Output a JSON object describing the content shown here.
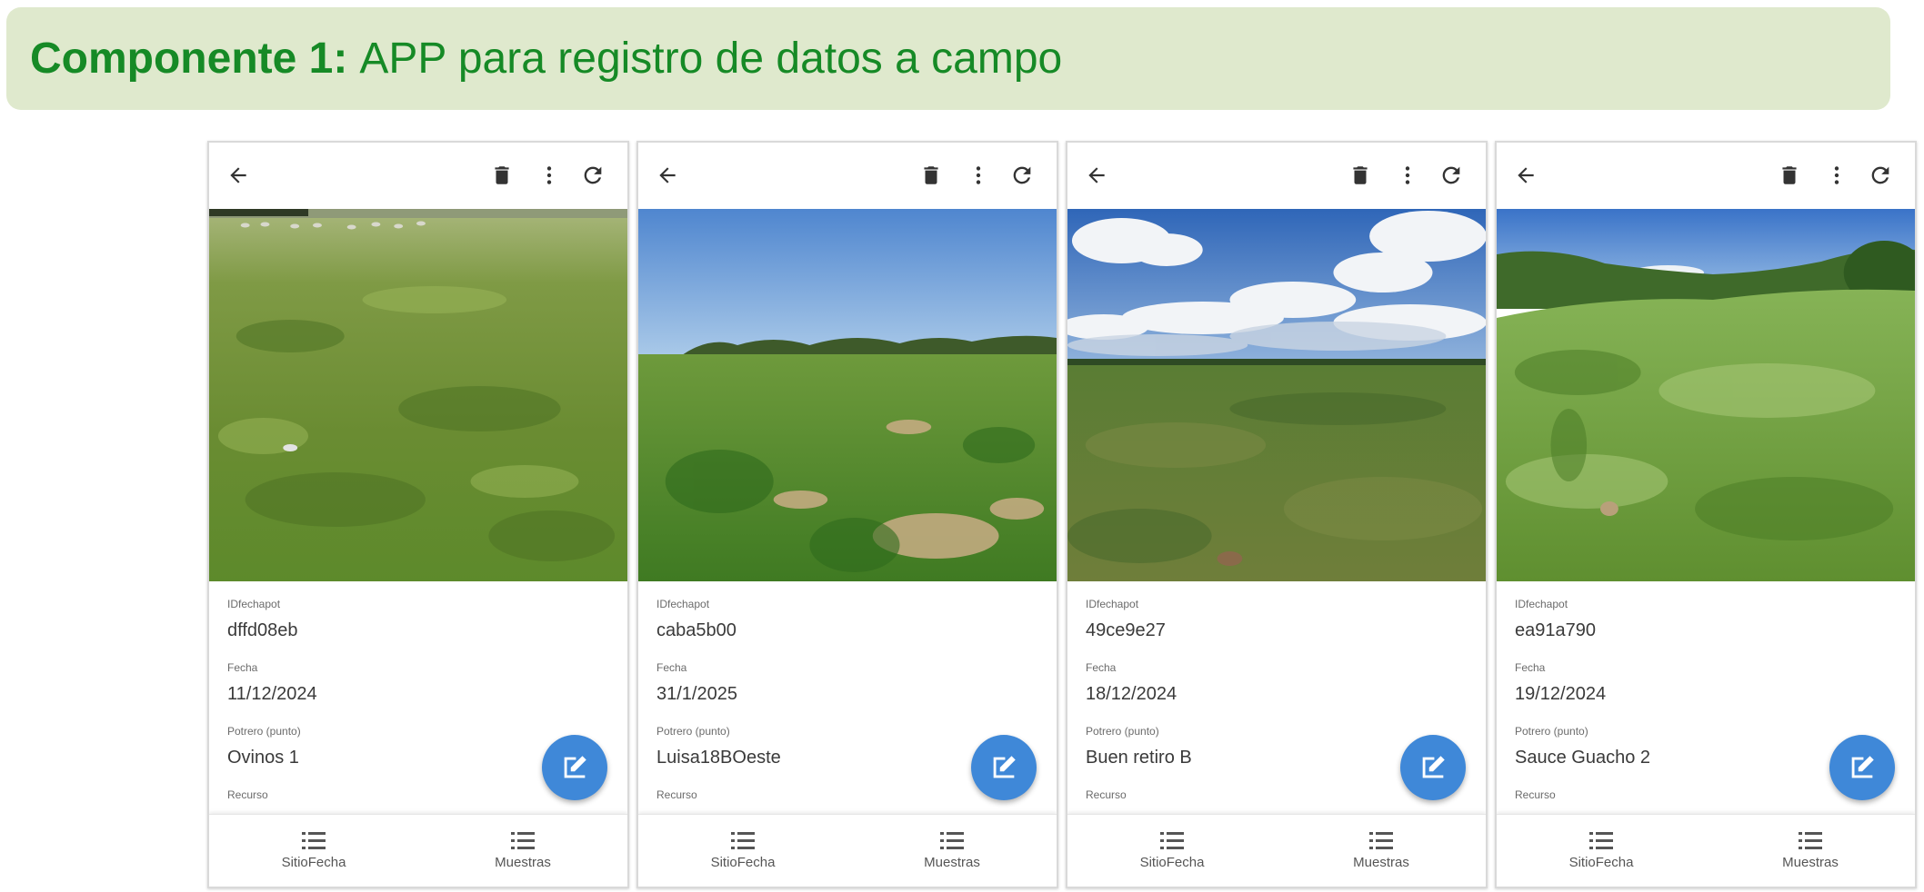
{
  "title": {
    "bold": "Componente 1:",
    "rest": "APP para registro de datos a campo"
  },
  "labels": {
    "idfechapot": "IDfechapot",
    "fecha": "Fecha",
    "potrero": "Potrero (punto)",
    "recurso": "Recurso"
  },
  "nav": {
    "sitiofecha": "SitioFecha",
    "muestras": "Muestras"
  },
  "icons": {
    "back": "arrow-left-icon",
    "delete": "trash-icon",
    "more": "more-vert-icon",
    "refresh": "refresh-icon",
    "edit": "edit-icon",
    "list": "list-icon"
  },
  "colors": {
    "banner_bg": "#dfe9cd",
    "banner_text": "#168a26",
    "fab": "#3f88d8"
  },
  "records": [
    {
      "id": "dffd08eb",
      "fecha": "11/12/2024",
      "potrero": "Ovinos 1"
    },
    {
      "id": "caba5b00",
      "fecha": "31/1/2025",
      "potrero": "Luisa18BOeste"
    },
    {
      "id": "49ce9e27",
      "fecha": "18/12/2024",
      "potrero": "Buen retiro B"
    },
    {
      "id": "ea91a790",
      "fecha": "19/12/2024",
      "potrero": "Sauce Guacho 2"
    }
  ]
}
